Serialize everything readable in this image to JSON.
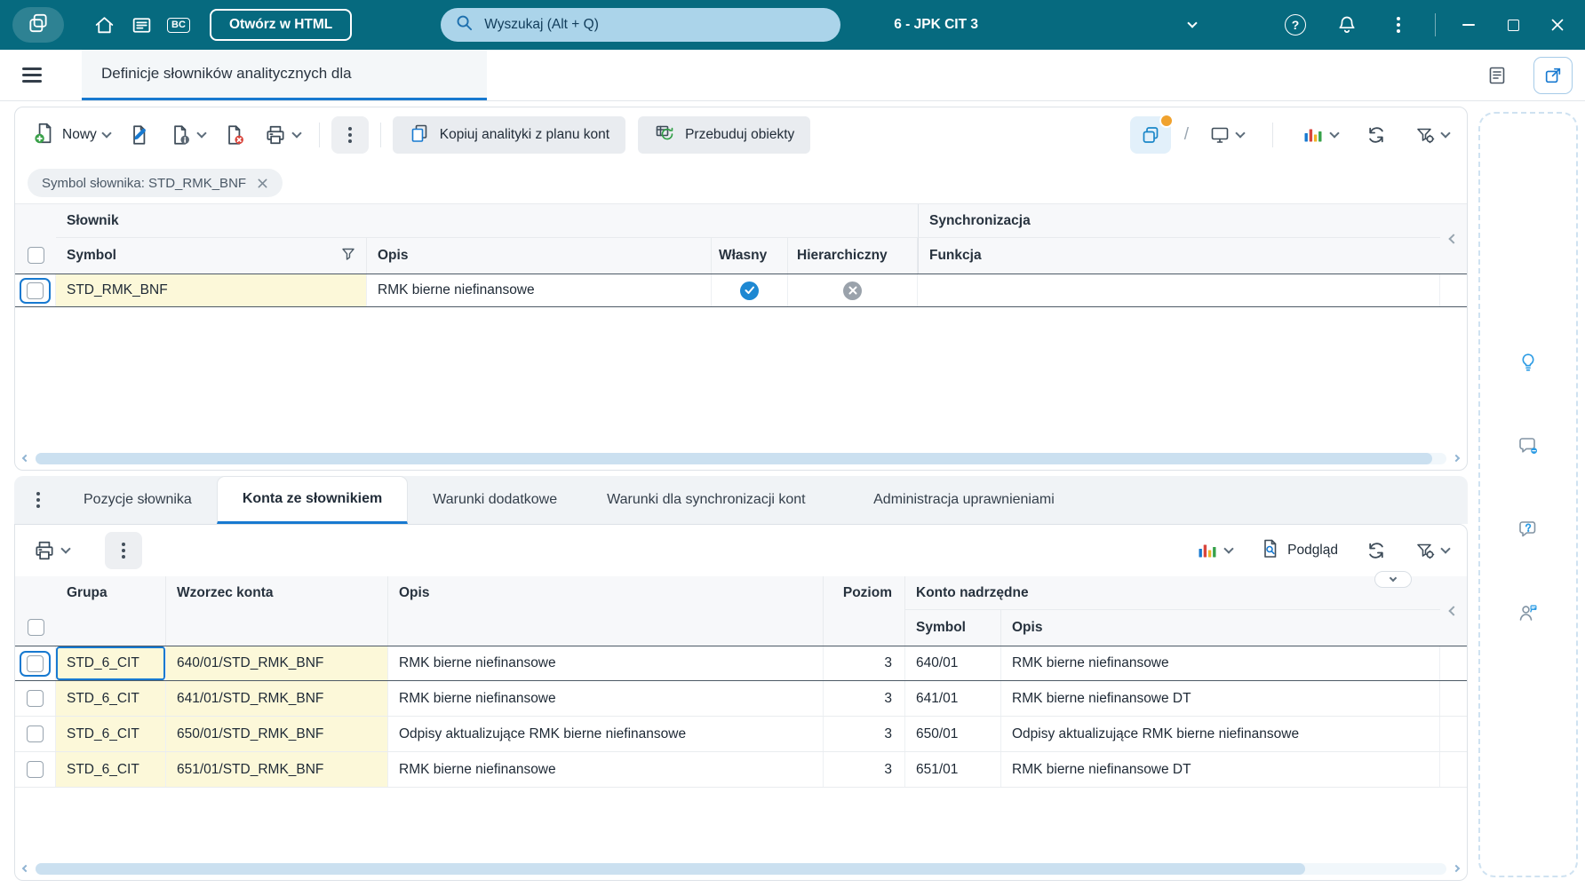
{
  "titlebar": {
    "bc_badge": "BC",
    "open_html_button": "Otwórz w HTML",
    "search_placeholder": "Wyszukaj (Alt + Q)",
    "context_selector": "6 - JPK CIT 3"
  },
  "icons": {
    "question": "?",
    "slash": "/"
  },
  "header": {
    "main_tab": "Definicje słowników analitycznych dla"
  },
  "toolbar": {
    "new_button": "Nowy",
    "copy_analytics_button": "Kopiuj analityki z planu kont",
    "rebuild_button": "Przebuduj obiekty"
  },
  "filters": {
    "symbol_chip": "Symbol słownika: STD_RMK_BNF"
  },
  "dictionary_table": {
    "group_slownik": "Słownik",
    "group_synchronizacja": "Synchronizacja",
    "col_symbol": "Symbol",
    "col_opis": "Opis",
    "col_wlasny": "Własny",
    "col_hierarchiczny": "Hierarchiczny",
    "col_funkcja": "Funkcja",
    "row": {
      "symbol": "STD_RMK_BNF",
      "opis": "RMK bierne niefinansowe",
      "wlasny": true,
      "hierarchiczny": false,
      "funkcja": ""
    }
  },
  "section_tabs": {
    "pozycje": "Pozycje słownika",
    "konta": "Konta ze słownikiem",
    "warunki_dodatkowe": "Warunki dodatkowe",
    "warunki_synchronizacji": "Warunki dla synchronizacji kont",
    "administracja": "Administracja uprawnieniami"
  },
  "accounts_toolbar": {
    "preview_button": "Podgląd"
  },
  "accounts_table": {
    "col_grupa": "Grupa",
    "col_wzorzec_konta": "Wzorzec konta",
    "col_opis": "Opis",
    "col_poziom": "Poziom",
    "group_konto_nadrzedne": "Konto nadrzędne",
    "col_nadrzedne_symbol": "Symbol",
    "col_nadrzedne_opis": "Opis",
    "rows": [
      {
        "grupa": "STD_6_CIT",
        "wzorzec_konta": "640/01/STD_RMK_BNF",
        "opis": "RMK bierne niefinansowe",
        "poziom": "3",
        "nadrzedne_symbol": "640/01",
        "nadrzedne_opis": "RMK bierne niefinansowe"
      },
      {
        "grupa": "STD_6_CIT",
        "wzorzec_konta": "641/01/STD_RMK_BNF",
        "opis": "RMK bierne niefinansowe",
        "poziom": "3",
        "nadrzedne_symbol": "641/01",
        "nadrzedne_opis": "RMK bierne niefinansowe DT"
      },
      {
        "grupa": "STD_6_CIT",
        "wzorzec_konta": "650/01/STD_RMK_BNF",
        "opis": "Odpisy aktualizujące RMK bierne niefinansowe",
        "poziom": "3",
        "nadrzedne_symbol": "650/01",
        "nadrzedne_opis": "Odpisy aktualizujące RMK bierne niefinansowe"
      },
      {
        "grupa": "STD_6_CIT",
        "wzorzec_konta": "651/01/STD_RMK_BNF",
        "opis": "RMK bierne niefinansowe",
        "poziom": "3",
        "nadrzedne_symbol": "651/01",
        "nadrzedne_opis": "RMK bierne niefinansowe DT"
      }
    ]
  },
  "colors": {
    "titlebar_teal": "#066a7f",
    "accent_blue": "#1779d0",
    "highlight_yellow": "#fcf8d9",
    "true_badge_blue": "#1e88d2",
    "false_badge_gray": "#9aa2ab"
  }
}
